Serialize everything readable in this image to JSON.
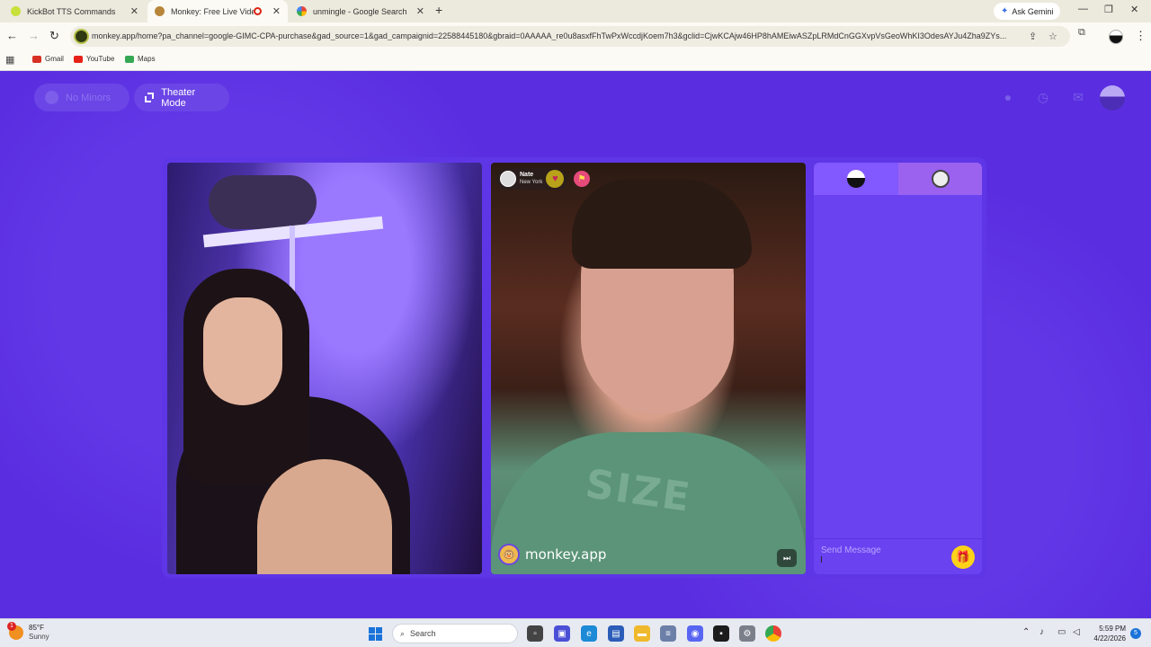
{
  "browser": {
    "tabs": [
      {
        "title": "KickBot TTS Commands",
        "active": false
      },
      {
        "title": "Monkey: Free Live Video Ch",
        "active": true,
        "recording": true
      },
      {
        "title": "unmingle - Google Search",
        "active": false
      }
    ],
    "new_tab_label": "+",
    "ask_gemini_label": "Ask Gemini",
    "window_controls": {
      "minimize": "—",
      "restore": "❐",
      "close": "✕"
    },
    "url": "monkey.app/home?pa_channel=google-GIMC-CPA-purchase&gad_source=1&gad_campaignid=22588445180&gbraid=0AAAAA_re0u8asxfFhTwPxWccdjKoem7h3&gclid=CjwKCAjw46HP8hAMEiwASZpLRMdCnGGXvpVsGeoWhKI3OdesAYJu4Zha9ZYs...",
    "bookmarks": [
      {
        "label": "Gmail",
        "color": "#d93025"
      },
      {
        "label": "YouTube",
        "color": "#e62117"
      },
      {
        "label": "Maps",
        "color": "#34a853"
      }
    ]
  },
  "monkey": {
    "no_minors_label": "No Minors",
    "theater_mode_label": "Theater Mode",
    "accent_color": "#5a2ee0",
    "caller": {
      "name": "Nate",
      "location": "New York"
    },
    "brand_label": "monkey.app",
    "shirt_text": "SIZE",
    "chat": {
      "placeholder": "Send Message"
    }
  },
  "taskbar": {
    "weather_badge": "1",
    "weather_temp": "85°F",
    "weather_condition": "Sunny",
    "search_label": "Search",
    "time": "5:59 PM",
    "date": "4/22/2026",
    "notification_count": "5"
  }
}
